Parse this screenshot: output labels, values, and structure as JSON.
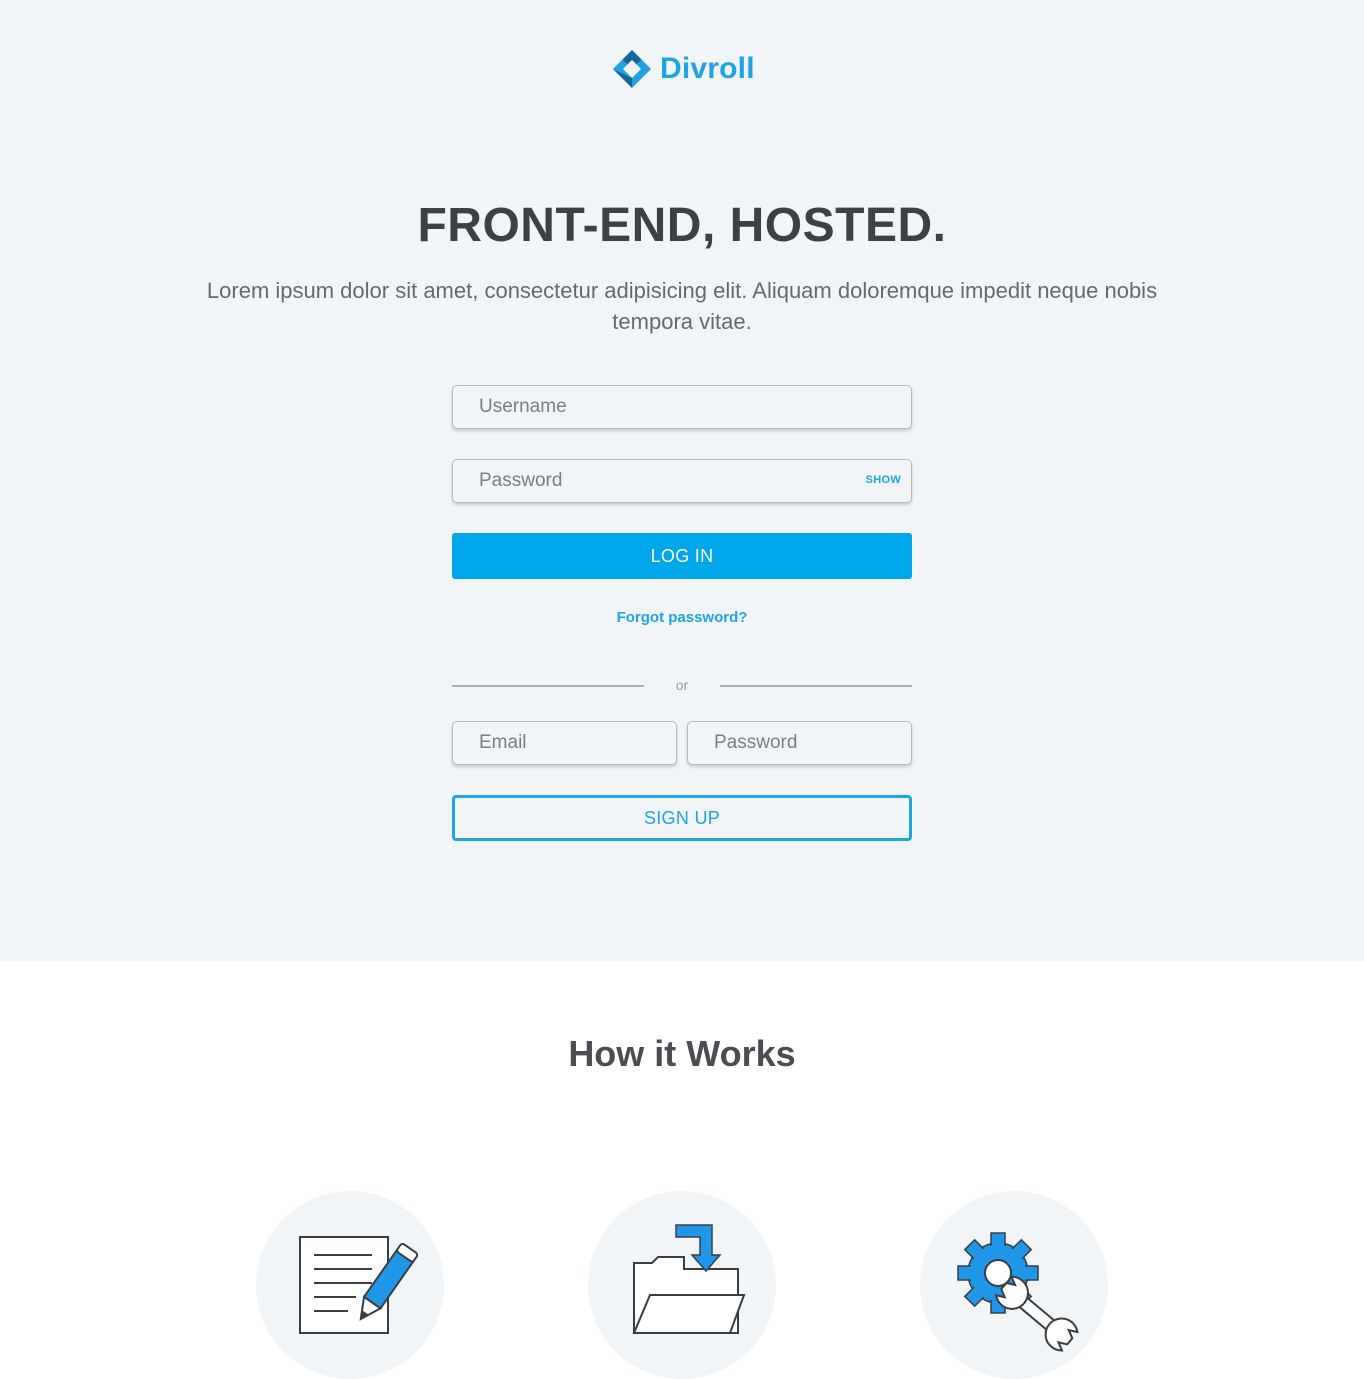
{
  "brand": {
    "name": "Divroll",
    "accent": "#1fa3e3",
    "button_blue": "#00a7eb",
    "logo_icon": "diamond-logo-icon"
  },
  "hero": {
    "headline": "FRONT-END, HOSTED.",
    "subtext": "Lorem ipsum dolor sit amet, consectetur adipisicing elit. Aliquam doloremque impedit neque nobis tempora vitae."
  },
  "login": {
    "username_placeholder": "Username",
    "password_placeholder": "Password",
    "show_label": "SHOW",
    "login_label": "LOG IN",
    "forgot_label": "Forgot password?"
  },
  "divider": {
    "label": "or"
  },
  "signup": {
    "email_placeholder": "Email",
    "password_placeholder": "Password",
    "signup_label": "SIGN UP"
  },
  "how": {
    "title": "How it Works",
    "steps": [
      {
        "icon": "document-edit-icon"
      },
      {
        "icon": "folder-download-icon"
      },
      {
        "icon": "settings-tools-icon"
      }
    ]
  }
}
